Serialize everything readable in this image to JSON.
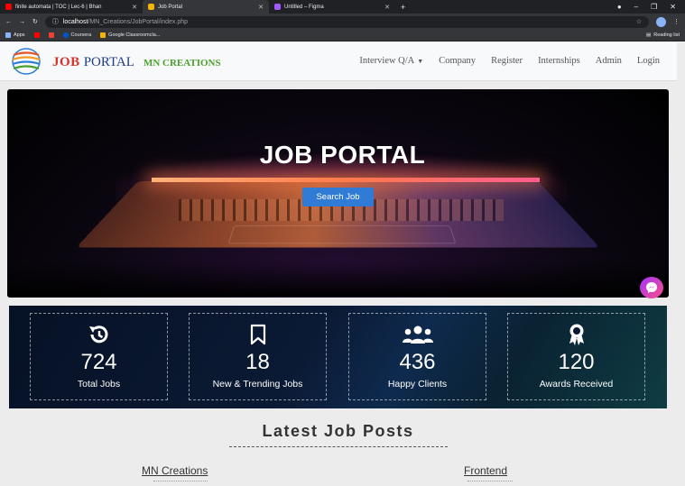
{
  "browser": {
    "tabs": [
      {
        "label": "finite automata | TOC | Lec-6 | Bhan",
        "favicon_color": "#ff0000",
        "active": false
      },
      {
        "label": "Job Portal",
        "favicon_color": "#f4b400",
        "active": true
      },
      {
        "label": "Untitled – Figma",
        "favicon_color": "#a259ff",
        "active": false
      }
    ],
    "new_tab": "+",
    "url_host": "localhost",
    "url_path": "/MN_Creations/JobPortal/index.php",
    "bookmarks": [
      {
        "label": "Apps",
        "color": "#8ab4f8"
      },
      {
        "label": "",
        "color": "#ff0000"
      },
      {
        "label": "",
        "color": "#ea4335"
      },
      {
        "label": "Coursera",
        "color": "#0056d2"
      },
      {
        "label": "Google Classroomcla...",
        "color": "#f4b400"
      }
    ],
    "reading_list": "Reading list"
  },
  "site": {
    "brand_job": "JOB",
    "brand_portal": "PORTAL",
    "brand_mn": "MN CREATIONS",
    "nav": [
      "Interview Q/A",
      "Company",
      "Register",
      "Internships",
      "Admin",
      "Login"
    ]
  },
  "hero": {
    "title": "JOB PORTAL",
    "button": "Search Job"
  },
  "stats": [
    {
      "icon": "history-icon",
      "value": "724",
      "label": "Total Jobs"
    },
    {
      "icon": "bookmark-icon",
      "value": "18",
      "label": "New & Trending Jobs"
    },
    {
      "icon": "users-icon",
      "value": "436",
      "label": "Happy Clients"
    },
    {
      "icon": "award-icon",
      "value": "120",
      "label": "Awards Received"
    }
  ],
  "latest": {
    "title": "Latest Job Posts",
    "posts": [
      "MN Creations",
      "Frontend"
    ]
  }
}
